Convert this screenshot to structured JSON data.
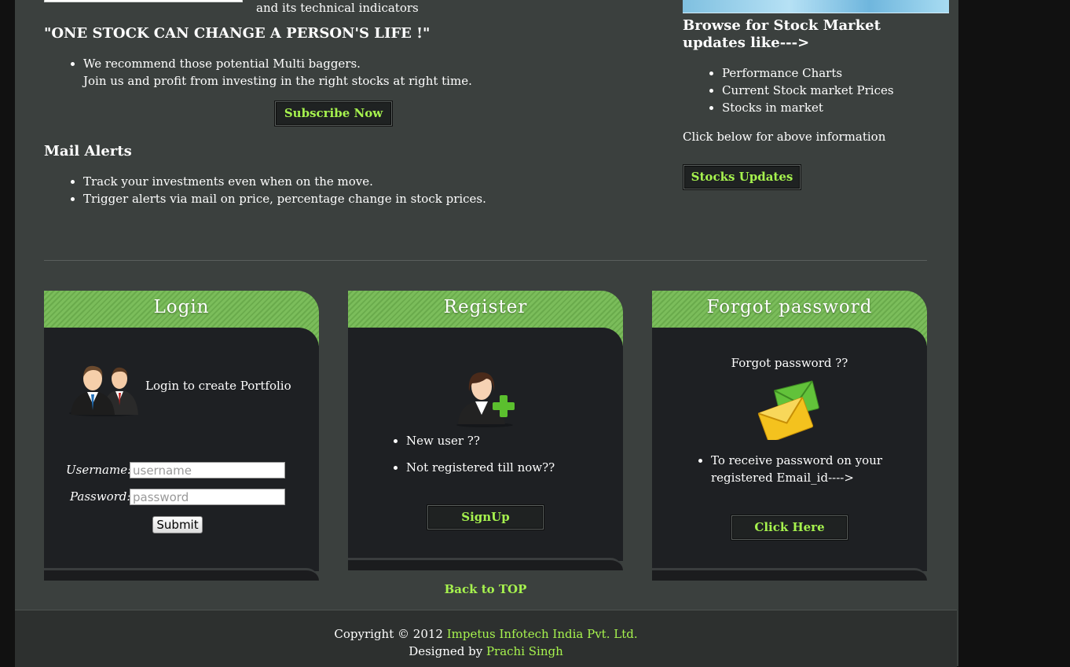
{
  "top": {
    "indicators_text": "and its technical indicators",
    "quote": "\"ONE STOCK CAN CHANGE A PERSON'S LIFE !\"",
    "recommend_line1": "We recommend those potential Multi baggers.",
    "recommend_line2": "Join us and profit from investing in the right stocks at right time.",
    "subscribe_label": "Subscribe Now",
    "mail_alerts_heading": "Mail Alerts",
    "mail_alerts_items": [
      "Track your investments even when on the move.",
      "Trigger alerts via mail on price, percentage change in stock prices."
    ]
  },
  "browse": {
    "heading": "Browse for Stock Market updates like--->",
    "items": [
      "Performance Charts",
      "Current Stock market Prices",
      "Stocks in market"
    ],
    "click_below": "Click below for above information",
    "button_label": "Stocks Updates"
  },
  "login": {
    "title": "Login",
    "caption": "Login to create Portfolio",
    "username_label": "Username:",
    "username_placeholder": "username",
    "password_label": "Password:",
    "password_placeholder": "password",
    "submit_label": "Submit"
  },
  "register": {
    "title": "Register",
    "items": [
      "New user ??",
      "Not registered till now??"
    ],
    "button_label": "SignUp"
  },
  "forgot": {
    "title": "Forgot password",
    "caption": "Forgot password ??",
    "item_line1": "To receive password on your",
    "item_line2": "registered Email_id---->",
    "button_label": "Click Here"
  },
  "back_to_top": "Back to TOP",
  "footer": {
    "copyright_prefix": "Copyright © 2012 ",
    "company": "Impetus Infotech India Pvt. Ltd.",
    "designed_prefix": "Designed by ",
    "designer": "Prachi Singh"
  },
  "colors": {
    "accent_green": "#a6f24e",
    "panel_header_green": "#7bbd5b",
    "page_bg": "#3b403e",
    "panel_bg": "#1e2023"
  },
  "icons": {
    "login": "users-icon",
    "register": "add-user-icon",
    "forgot": "envelopes-icon"
  }
}
